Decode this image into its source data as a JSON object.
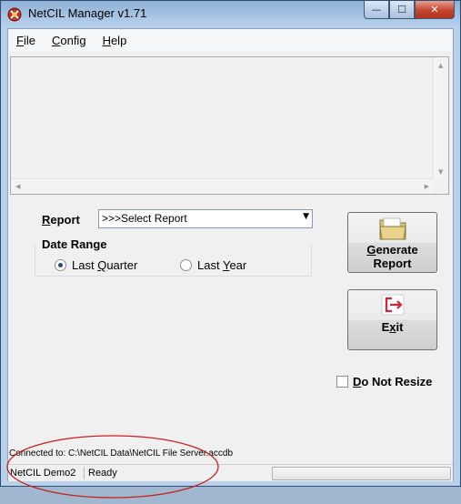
{
  "window": {
    "title": "NetCIL Manager v1.71",
    "caption_buttons": {
      "minimize": "—",
      "maximize": "☐",
      "close": "✕"
    }
  },
  "menu": {
    "items": [
      {
        "accel": "F",
        "rest": "ile"
      },
      {
        "accel": "C",
        "rest": "onfig"
      },
      {
        "accel": "H",
        "rest": "elp"
      }
    ]
  },
  "report": {
    "label_accel": "R",
    "label_rest": "eport",
    "selected": ">>>Select Report",
    "dropdown_icon": "chevron-down"
  },
  "date_range": {
    "title": "Date Range",
    "options": [
      {
        "pre": "Last ",
        "accel": "Q",
        "post": "uarter",
        "checked": true
      },
      {
        "pre": "Last ",
        "accel": "Y",
        "post": "ear",
        "checked": false
      }
    ]
  },
  "buttons": {
    "generate": {
      "line1_accel": "G",
      "line1_rest": "enerate",
      "line2": "Report",
      "icon": "folder-icon"
    },
    "exit": {
      "pre": "E",
      "accel": "x",
      "post": "it",
      "icon": "exit-icon"
    }
  },
  "do_not_resize": {
    "accel": "D",
    "rest": "o Not Resize",
    "checked": false
  },
  "connection": {
    "text": "Connected to: C:\\NetCIL Data\\NetCIL File Server.accdb"
  },
  "statusbar": {
    "host": "NetCIL Demo2",
    "status": "Ready"
  },
  "colors": {
    "title_bar": "#a8c5e4",
    "close_button": "#c2452e",
    "annotation_ellipse": "#cc1f1f"
  }
}
